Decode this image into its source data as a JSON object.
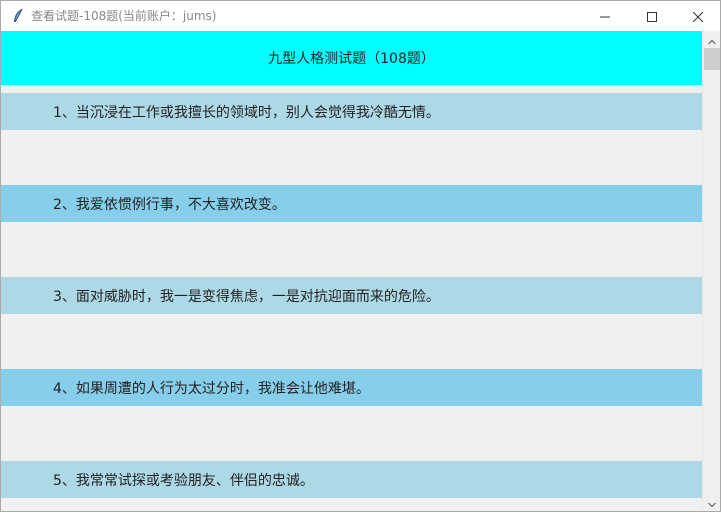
{
  "window": {
    "title": "查看试题-108题(当前账户：jums)",
    "icon": "feather-icon",
    "controls": {
      "minimize_icon": "minimize-icon",
      "maximize_icon": "maximize-icon",
      "close_icon": "close-icon"
    }
  },
  "header": {
    "title": "九型人格测试题（108题）",
    "background": "#00ffff"
  },
  "questions": [
    {
      "text": "1、当沉浸在工作或我擅长的领域时，别人会觉得我冷酷无情。"
    },
    {
      "text": "2、我爱依惯例行事，不大喜欢改变。"
    },
    {
      "text": "3、面对威胁时，我一是变得焦虑，一是对抗迎面而来的危险。"
    },
    {
      "text": "4、如果周遭的人行为太过分时，我准会让他难堪。"
    },
    {
      "text": "5、我常常试探或考验朋友、伴侣的忠诚。"
    }
  ],
  "colors": {
    "row_light": "#add8e6",
    "row_sky": "#87ceeb",
    "gap": "#f0f0f0"
  },
  "scrollbar": {
    "up_icon": "scroll-up-arrow-icon",
    "down_icon": "scroll-down-arrow-icon"
  }
}
